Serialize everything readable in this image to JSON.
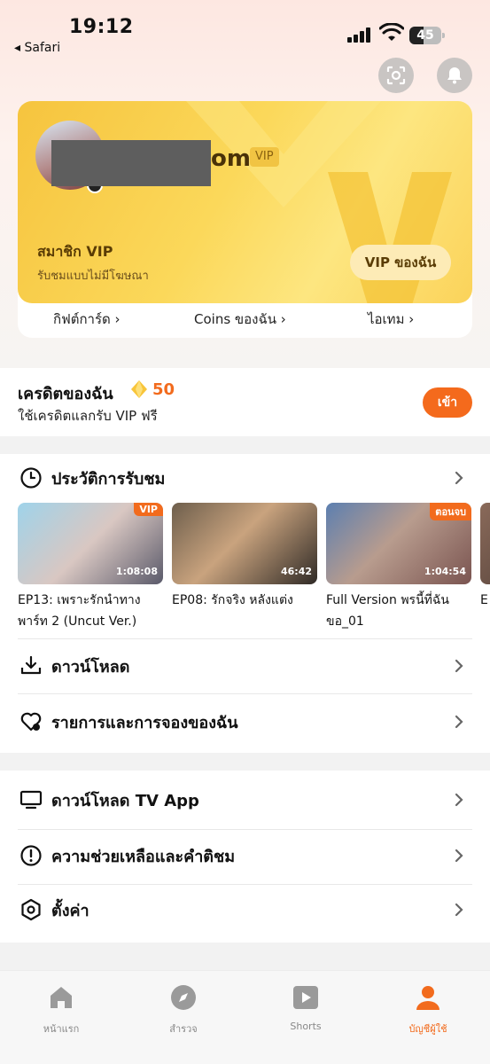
{
  "status_bar": {
    "time": "19:12",
    "back_app": "◂ Safari",
    "battery": "45",
    "battery_level": 0.45
  },
  "header": {
    "scan_icon": "scan-icon",
    "bell_icon": "bell-icon"
  },
  "vip_card": {
    "username_tail": "om",
    "vip_tag": "VIP",
    "title": "สมาชิก VIP",
    "subtitle": "รับชมแบบไม่มีโฆษณา",
    "button": "VIP ของฉัน",
    "links": [
      {
        "label": "กิฟต์การ์ด"
      },
      {
        "label": "Coins ของฉัน"
      },
      {
        "label": "ไอเทม"
      }
    ]
  },
  "credit": {
    "title": "เครดิตของฉัน",
    "amount": "50",
    "subtitle": "ใช้เครดิตแลกรับ VIP ฟรี",
    "button": "เข้า"
  },
  "history": {
    "title": "ประวัติการรับชม",
    "items": [
      {
        "title": "EP13: เพราะรักนำทาง พาร์ท 2 (Uncut Ver.)",
        "duration": "1:08:08",
        "tag": "VIP",
        "tag_color": "#f26b1d"
      },
      {
        "title": "EP08: รักจริง หลังแต่ง",
        "duration": "46:42",
        "tag": "",
        "tag_color": ""
      },
      {
        "title": "Full Version พรนี้ที่ฉันขอ_01",
        "duration": "1:04:54",
        "tag": "ตอนจบ",
        "tag_color": "#f26b1d"
      },
      {
        "title": "E",
        "duration": "",
        "tag": "",
        "tag_color": ""
      }
    ]
  },
  "menu_1": [
    {
      "label": "ดาวน์โหลด",
      "icon": "download-icon"
    },
    {
      "label": "รายการและการจองของฉัน",
      "icon": "heart-icon"
    }
  ],
  "menu_2": [
    {
      "label": "ดาวน์โหลด TV App",
      "icon": "monitor-icon"
    },
    {
      "label": "ความช่วยเหลือและคำติชม",
      "icon": "help-icon"
    },
    {
      "label": "ตั้งค่า",
      "icon": "settings-icon"
    }
  ],
  "tabs": [
    {
      "label": "หน้าแรก",
      "icon": "home-icon"
    },
    {
      "label": "สำรวจ",
      "icon": "compass-icon"
    },
    {
      "label": "Shorts",
      "icon": "play-icon"
    },
    {
      "label": "บัญชีผู้ใช้",
      "icon": "user-icon"
    }
  ],
  "colors": {
    "accent": "#f26b1d",
    "vip_gold": "#fbd85a"
  }
}
